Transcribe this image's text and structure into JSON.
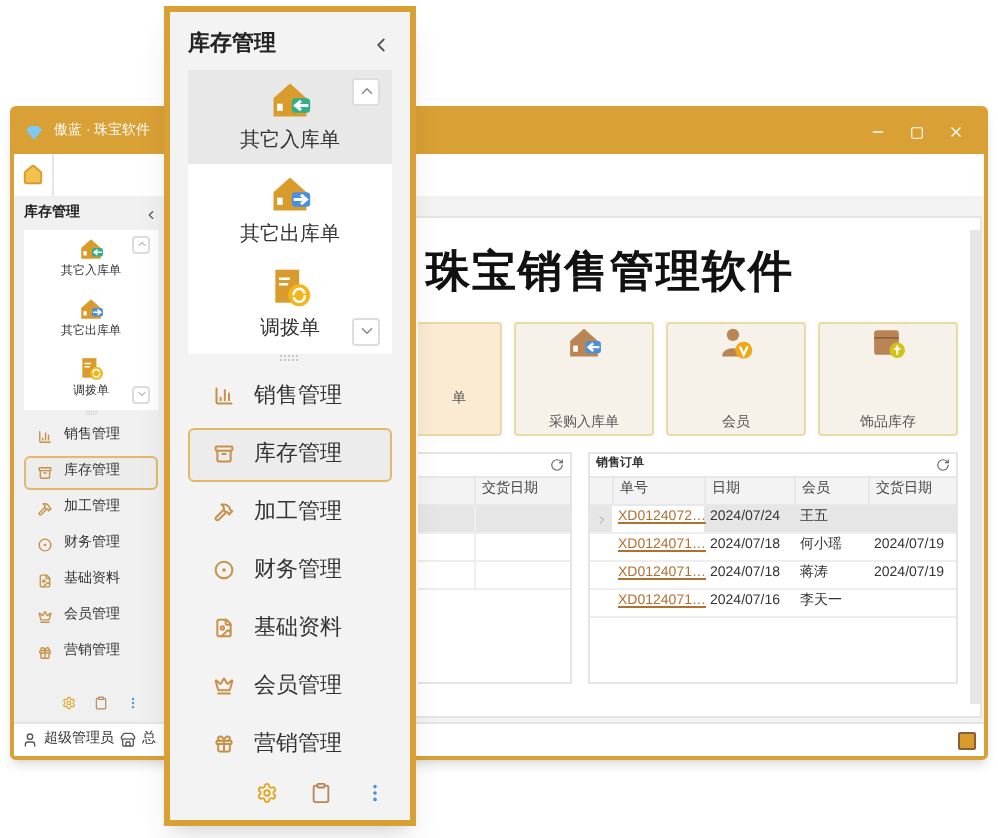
{
  "window": {
    "title": "傲蓝 · 珠宝软件"
  },
  "sidebar": {
    "title": "库存管理",
    "shortcuts": [
      {
        "label": "其它入库单",
        "kind": "in",
        "selected": false
      },
      {
        "label": "其它出库单",
        "kind": "out",
        "selected": false
      },
      {
        "label": "调拨单",
        "kind": "transfer",
        "selected": false
      }
    ],
    "menu": [
      {
        "label": "销售管理",
        "kind": "chart",
        "selected": false
      },
      {
        "label": "库存管理",
        "kind": "stock",
        "selected": true
      },
      {
        "label": "加工管理",
        "kind": "craft",
        "selected": false
      },
      {
        "label": "财务管理",
        "kind": "finance",
        "selected": false
      },
      {
        "label": "基础资料",
        "kind": "base",
        "selected": false
      },
      {
        "label": "会员管理",
        "kind": "member",
        "selected": false
      },
      {
        "label": "营销管理",
        "kind": "gift",
        "selected": false
      }
    ]
  },
  "home": {
    "title": "珠宝销售管理软件",
    "cards": [
      {
        "label": "单"
      },
      {
        "label": "采购入库单",
        "kind": "purchase"
      },
      {
        "label": "会员",
        "kind": "member"
      },
      {
        "label": "饰品库存",
        "kind": "box"
      }
    ]
  },
  "left_table": {
    "columns": [
      "交货日期"
    ],
    "rows": [
      {
        "selected": true
      },
      {
        "selected": false
      },
      {
        "selected": false
      }
    ]
  },
  "orders": {
    "title": "销售订单",
    "columns": [
      "单号",
      "日期",
      "会员",
      "交货日期"
    ],
    "rows": [
      {
        "selected": true,
        "no": "XD0124072…",
        "date": "2024/07/24",
        "member": "王五"
      },
      {
        "selected": false,
        "no": "XD0124071…",
        "date": "2024/07/18",
        "member": "何小瑶",
        "delivery": "2024/07/19"
      },
      {
        "selected": false,
        "no": "XD0124071…",
        "date": "2024/07/18",
        "member": "蒋涛",
        "delivery": "2024/07/19"
      },
      {
        "selected": false,
        "no": "XD0124071…",
        "date": "2024/07/16",
        "member": "李天一"
      }
    ]
  },
  "status_bar": {
    "user": "超级管理员",
    "store": "总"
  },
  "flyout": {
    "title": "库存管理",
    "shortcuts": [
      {
        "label": "其它入库单",
        "kind": "in",
        "selected": true
      },
      {
        "label": "其它出库单",
        "kind": "out",
        "selected": false
      },
      {
        "label": "调拨单",
        "kind": "transfer",
        "selected": false
      }
    ],
    "menu": [
      {
        "label": "销售管理",
        "kind": "chart",
        "selected": false
      },
      {
        "label": "库存管理",
        "kind": "stock",
        "selected": true
      },
      {
        "label": "加工管理",
        "kind": "craft",
        "selected": false
      },
      {
        "label": "财务管理",
        "kind": "finance",
        "selected": false
      },
      {
        "label": "基础资料",
        "kind": "base",
        "selected": false
      },
      {
        "label": "会员管理",
        "kind": "member",
        "selected": false
      },
      {
        "label": "营销管理",
        "kind": "gift",
        "selected": false
      }
    ]
  }
}
